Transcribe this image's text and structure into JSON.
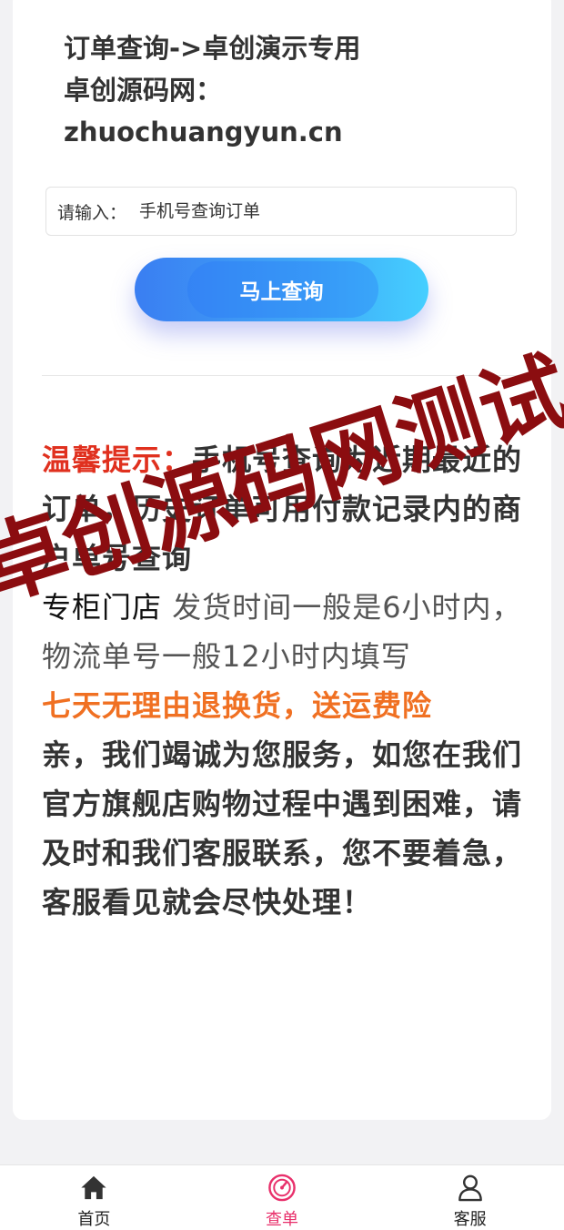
{
  "header": {
    "line1": "订单查询->卓创演示专用",
    "line2": "卓创源码网：",
    "line3": "zhuochuangyun.cn"
  },
  "search": {
    "prefix_label": "请输入：",
    "placeholder": "手机号查询订单",
    "button_label": "马上查询"
  },
  "notice": {
    "warm_tip_label": "温馨提示：",
    "warm_tip_text": "手机号查询为近期最近的订单，历史订单可用付款记录内的商户单号查询",
    "store_label": "专柜门店",
    "store_text": " 发货时间一般是6小时内，物流单号一般12小时内填写",
    "return_policy": "七天无理由退换货，送运费险",
    "service_text": "亲，我们竭诚为您服务，如您在我们官方旗舰店购物过程中遇到困难，请及时和我们客服联系，您不要着急，客服看见就会尽快处理！"
  },
  "watermark": {
    "text": "卓创源码网测试"
  },
  "tabbar": {
    "tabs": [
      {
        "label": "首页",
        "icon": "home-icon"
      },
      {
        "label": "查单",
        "icon": "order-search-icon",
        "active": true
      },
      {
        "label": "客服",
        "icon": "user-icon"
      }
    ]
  },
  "colors": {
    "accent_red": "#e0301e",
    "accent_orange": "#f07022",
    "active_tab": "#e8306b",
    "button_start": "#3a7ef2",
    "button_end": "#45cfff",
    "watermark": "#8b0d10"
  }
}
